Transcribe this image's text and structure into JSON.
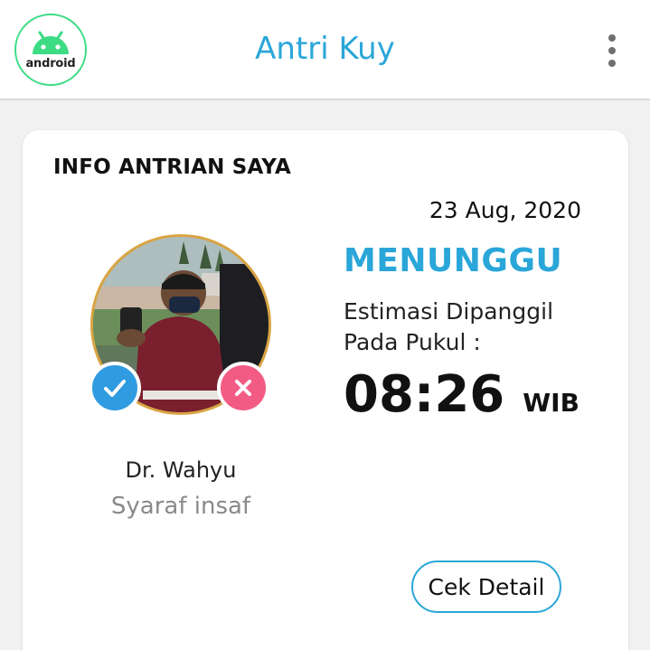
{
  "app": {
    "title": "Antri Kuy",
    "logo_text": "android",
    "logo_icon": "android-icon",
    "menu_icon": "more-vert-icon"
  },
  "card": {
    "title": "INFO ANTRIAN SAYA",
    "date": "23 Aug, 2020",
    "status": "MENUNGGU",
    "estimate_line1": "Estimasi Dipanggil",
    "estimate_line2": "Pada Pukul :",
    "time": "08:26",
    "timezone": "WIB",
    "doctor_name": "Dr. Wahyu",
    "patient_name": "Syaraf insaf",
    "detail_button": "Cek Detail",
    "accept_icon": "check-icon",
    "reject_icon": "close-icon"
  },
  "colors": {
    "accent": "#2aa6d9",
    "android_green": "#3ddc84",
    "accept": "#2f9be0",
    "reject": "#f25b84",
    "muted_text": "#8a8a8a"
  }
}
